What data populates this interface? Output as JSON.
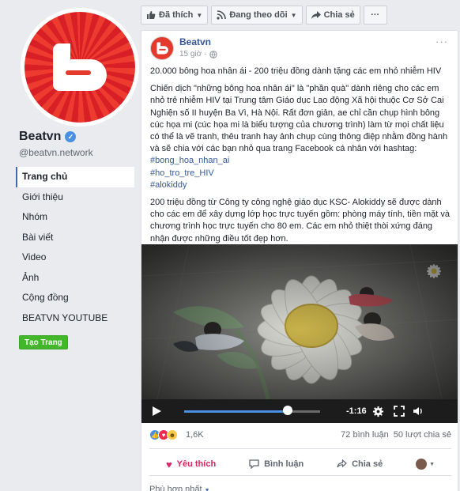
{
  "sidebar": {
    "page_name": "Beatvn",
    "handle": "@beatvn.network",
    "nav": [
      "Trang chủ",
      "Giới thiệu",
      "Nhóm",
      "Bài viết",
      "Video",
      "Ảnh",
      "Cộng đồng",
      "BEATVN YOUTUBE"
    ],
    "create_label": "Tạo Trang"
  },
  "topbar": {
    "liked": "Đã thích",
    "following": "Đang theo dõi",
    "share": "Chia sẻ",
    "more": "···"
  },
  "post": {
    "author": "Beatvn",
    "time": "15 giờ ·",
    "more": "···",
    "headline": "20.000 bông hoa nhân ái - 200 triệu đồng dành tặng các em nhỏ nhiễm HIV",
    "para1": "Chiến dịch \"những bông hoa nhân ái\" là \"phần quà\" dành riêng cho các em nhỏ trẻ nhiễm HIV tại Trung tâm Giáo dục Lao động Xã hội thuộc Cơ Sở Cai Nghiện số II huyện Ba Vì, Hà Nội. Rất đơn giản, ae chỉ cần chụp hình bông cúc họa mi (cúc họa mi là biểu tượng của chương trình) làm từ mọi chất liệu có thể là vẽ tranh, thêu tranh hay ảnh chụp cùng thông điệp nhằm đồng hành và sẽ chia với các bạn nhỏ qua trang Facebook cá nhân với hashtag:",
    "hashtags": [
      "#bong_hoa_nhan_ai",
      "#ho_tro_tre_HIV",
      "#alokiddy"
    ],
    "para2": "200 triệu đồng từ Công ty công nghệ giáo dục KSC- Alokiddy sẽ được dành cho các em để xây dựng lớp học trực tuyến gồm: phòng máy tính, tiền mặt và chương trình học trực tuyến cho 80 em. Các em nhỏ thiệt thòi xứng đáng nhận được những điều tốt đẹp hơn."
  },
  "video": {
    "remaining": "-1:16",
    "progress": 0.76
  },
  "stats": {
    "reaction_count": "1,6K",
    "comments": "72 bình luận",
    "shares": "50 lượt chia sẻ"
  },
  "actions": {
    "like": "Yêu thích",
    "comment": "Bình luận",
    "share": "Chia sẻ"
  },
  "sort_label": "Phù hợp nhất",
  "colors": {
    "brand_red": "#e43a2d",
    "link_blue": "#365899",
    "love_pink": "#e0245e",
    "create_green": "#42b72a"
  }
}
